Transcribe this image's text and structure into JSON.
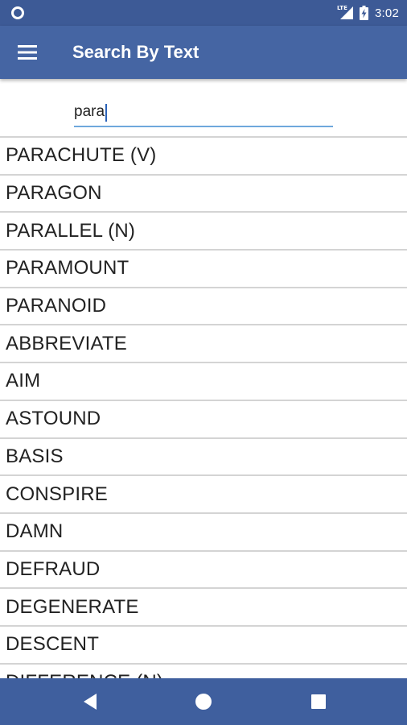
{
  "status_bar": {
    "network_label": "LTE",
    "time": "3:02",
    "icons": [
      "notification-circle-icon",
      "lte-signal-icon",
      "battery-charging-icon"
    ]
  },
  "app_bar": {
    "title": "Search By Text",
    "menu_icon": "hamburger-menu-icon"
  },
  "search": {
    "value": "para",
    "placeholder": ""
  },
  "results": [
    "PARACHUTE (V)",
    "PARAGON",
    "PARALLEL (N)",
    "PARAMOUNT",
    "PARANOID",
    "ABBREVIATE",
    "AIM",
    "ASTOUND",
    "BASIS",
    "CONSPIRE",
    "DAMN",
    "DEFRAUD",
    "DEGENERATE",
    "DESCENT",
    "DIFFERENCE (N)"
  ],
  "nav_bar": {
    "buttons": [
      "back-icon",
      "home-icon",
      "recents-icon"
    ]
  },
  "colors": {
    "status_bar": "#3d5a96",
    "app_bar": "#4565a3",
    "nav_bar": "#3f5f9e",
    "input_underline": "#6fa8dc",
    "divider": "#d4d4d4"
  }
}
